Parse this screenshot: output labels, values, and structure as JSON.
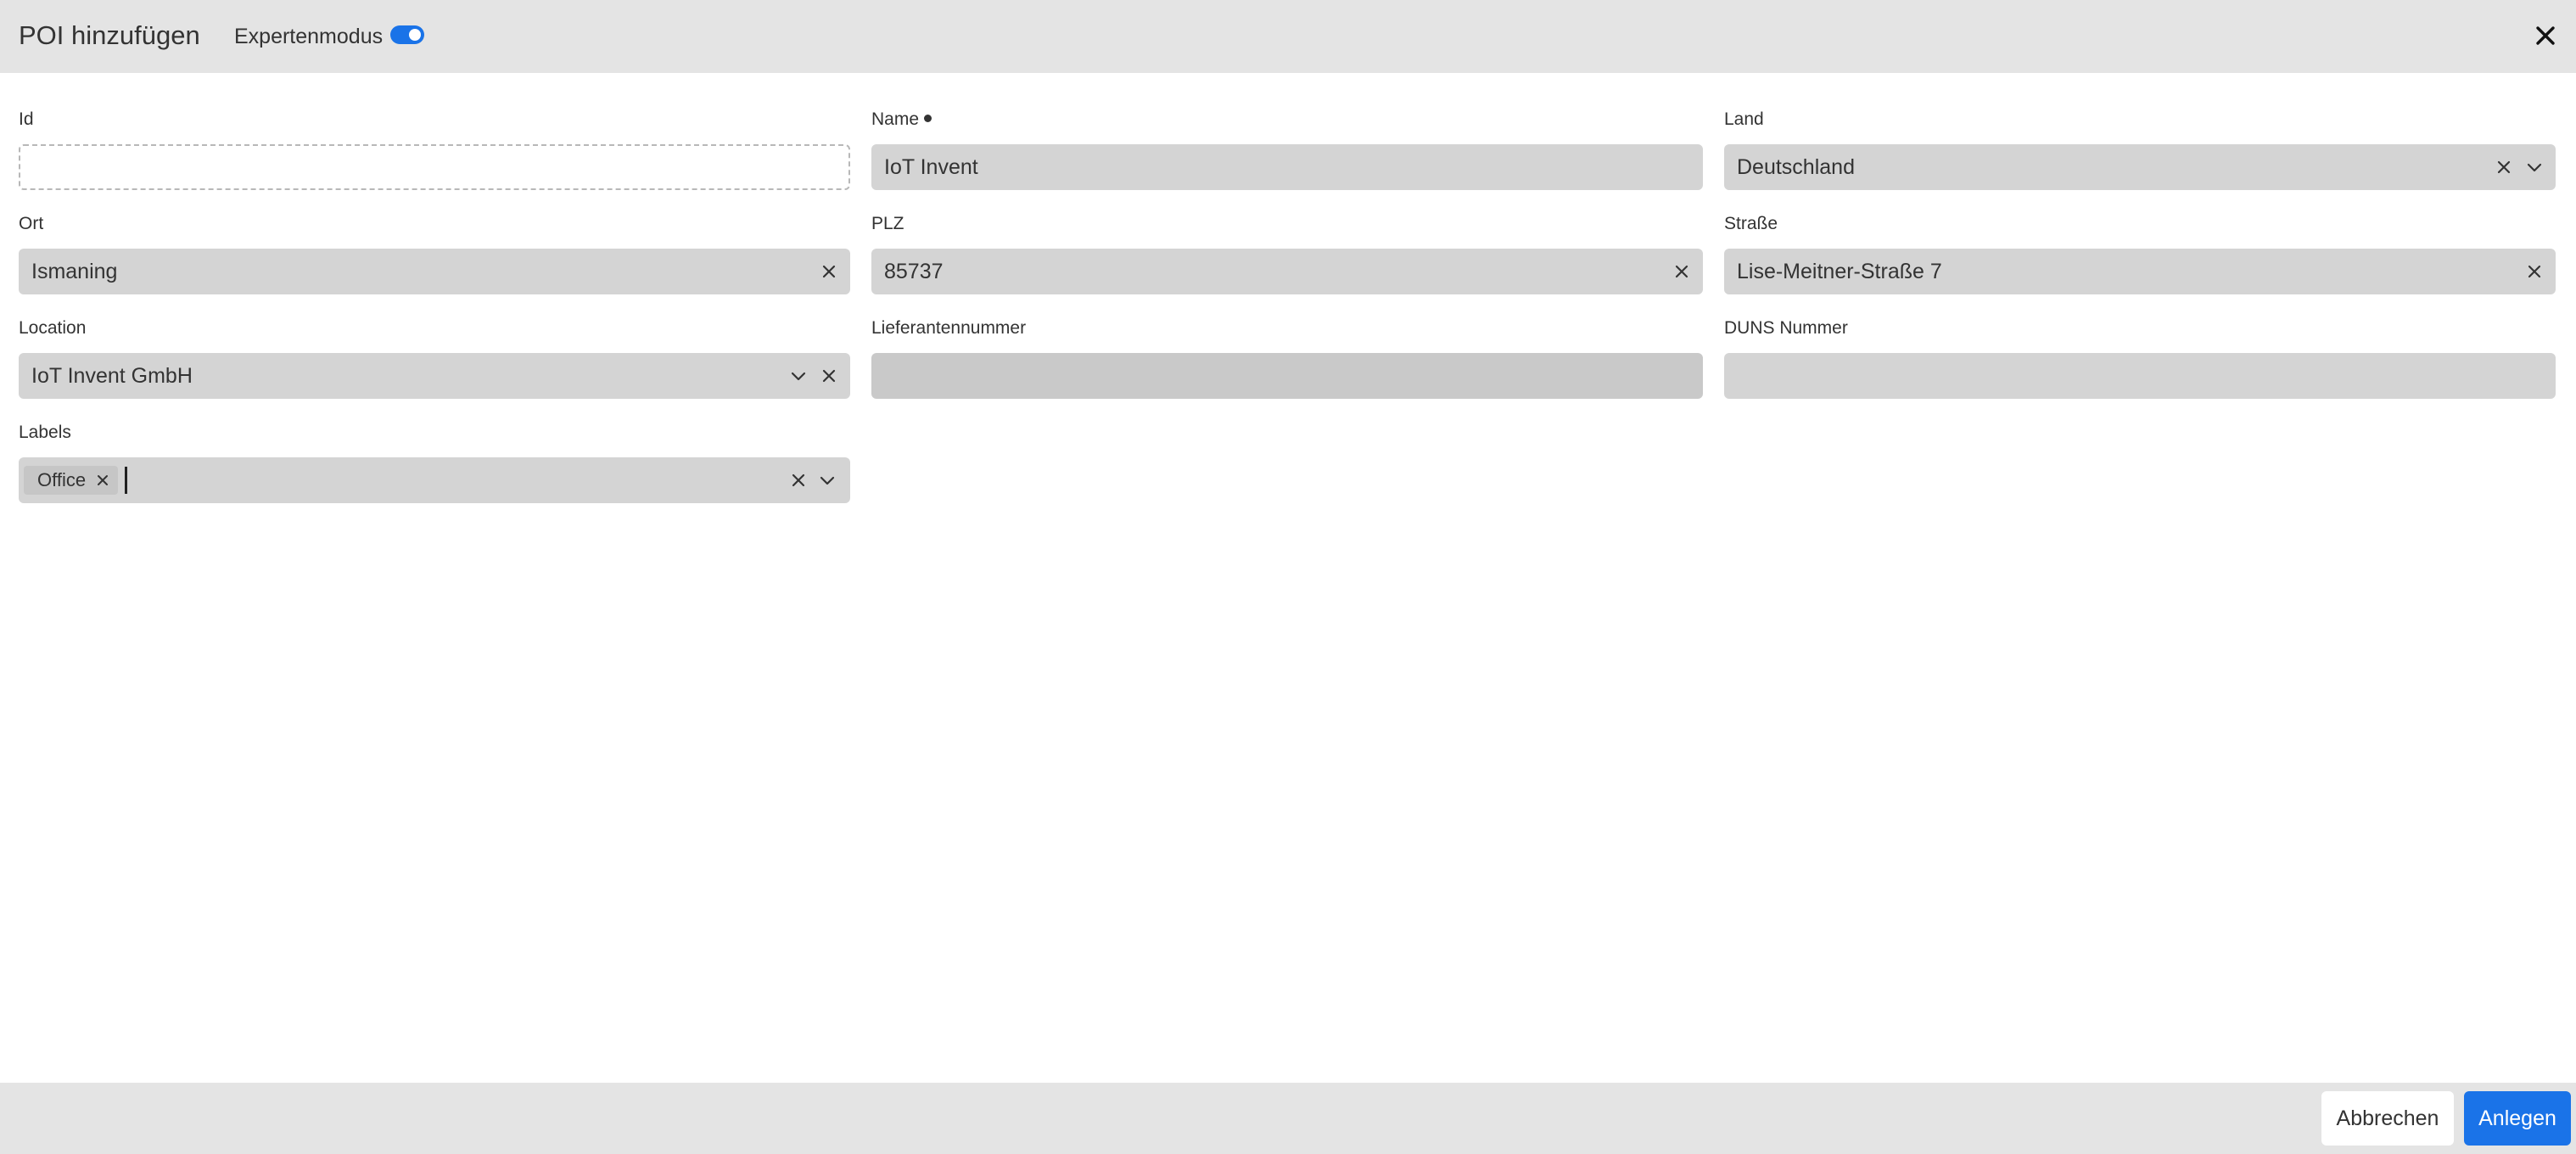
{
  "header": {
    "title": "POI hinzufügen",
    "expert_mode_label": "Expertenmodus",
    "expert_mode_on": true,
    "close_icon": "close-icon"
  },
  "fields": {
    "id": {
      "label": "Id",
      "value": ""
    },
    "name": {
      "label": "Name",
      "value": "IoT Invent",
      "required": true
    },
    "land": {
      "label": "Land",
      "value": "Deutschland"
    },
    "ort": {
      "label": "Ort",
      "value": "Ismaning"
    },
    "plz": {
      "label": "PLZ",
      "value": "85737"
    },
    "strasse": {
      "label": "Straße",
      "value": "Lise-Meitner-Straße 7"
    },
    "location": {
      "label": "Location",
      "value": "IoT Invent GmbH"
    },
    "lieferantennummer": {
      "label": "Lieferantennummer",
      "value": ""
    },
    "duns": {
      "label": "DUNS Nummer",
      "value": ""
    },
    "labels": {
      "label": "Labels",
      "chips": [
        "Office"
      ]
    }
  },
  "footer": {
    "cancel_label": "Abbrechen",
    "create_label": "Anlegen"
  },
  "colors": {
    "accent": "#1a73e8",
    "header_bg": "#e4e4e4",
    "input_bg": "#d4d4d4"
  }
}
